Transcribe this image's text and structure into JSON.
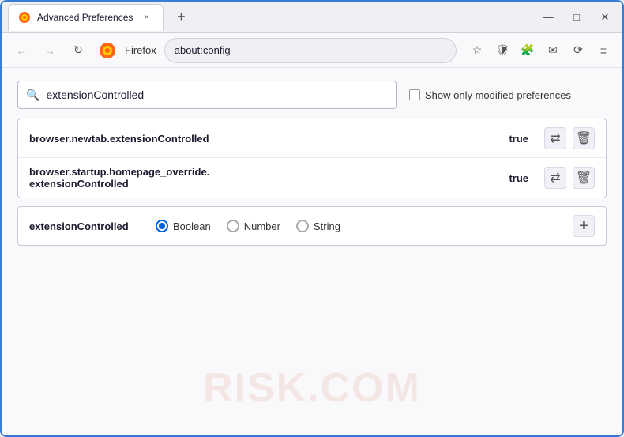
{
  "window": {
    "title": "Advanced Preferences",
    "tab_close": "×",
    "new_tab": "+",
    "win_minimize": "—",
    "win_maximize": "□",
    "win_close": "✕"
  },
  "navbar": {
    "back_icon": "←",
    "forward_icon": "→",
    "refresh_icon": "↻",
    "browser_name": "Firefox",
    "url": "about:config",
    "star_icon": "☆",
    "shield_icon": "🛡",
    "ext_icon": "🧩",
    "mail_icon": "✉",
    "sync_icon": "⟳",
    "menu_icon": "≡"
  },
  "search": {
    "placeholder": "extensionControlled",
    "value": "extensionControlled",
    "show_modified_label": "Show only modified preferences"
  },
  "results": [
    {
      "pref_name": "browser.newtab.extensionControlled",
      "value": "true"
    },
    {
      "pref_name_line1": "browser.startup.homepage_override.",
      "pref_name_line2": "extensionControlled",
      "value": "true"
    }
  ],
  "add_pref": {
    "name": "extensionControlled",
    "types": [
      {
        "label": "Boolean",
        "selected": true
      },
      {
        "label": "Number",
        "selected": false
      },
      {
        "label": "String",
        "selected": false
      }
    ],
    "add_button": "+"
  },
  "watermark": "RISK.COM",
  "icons": {
    "reset": "⇄",
    "delete": "🗑"
  }
}
